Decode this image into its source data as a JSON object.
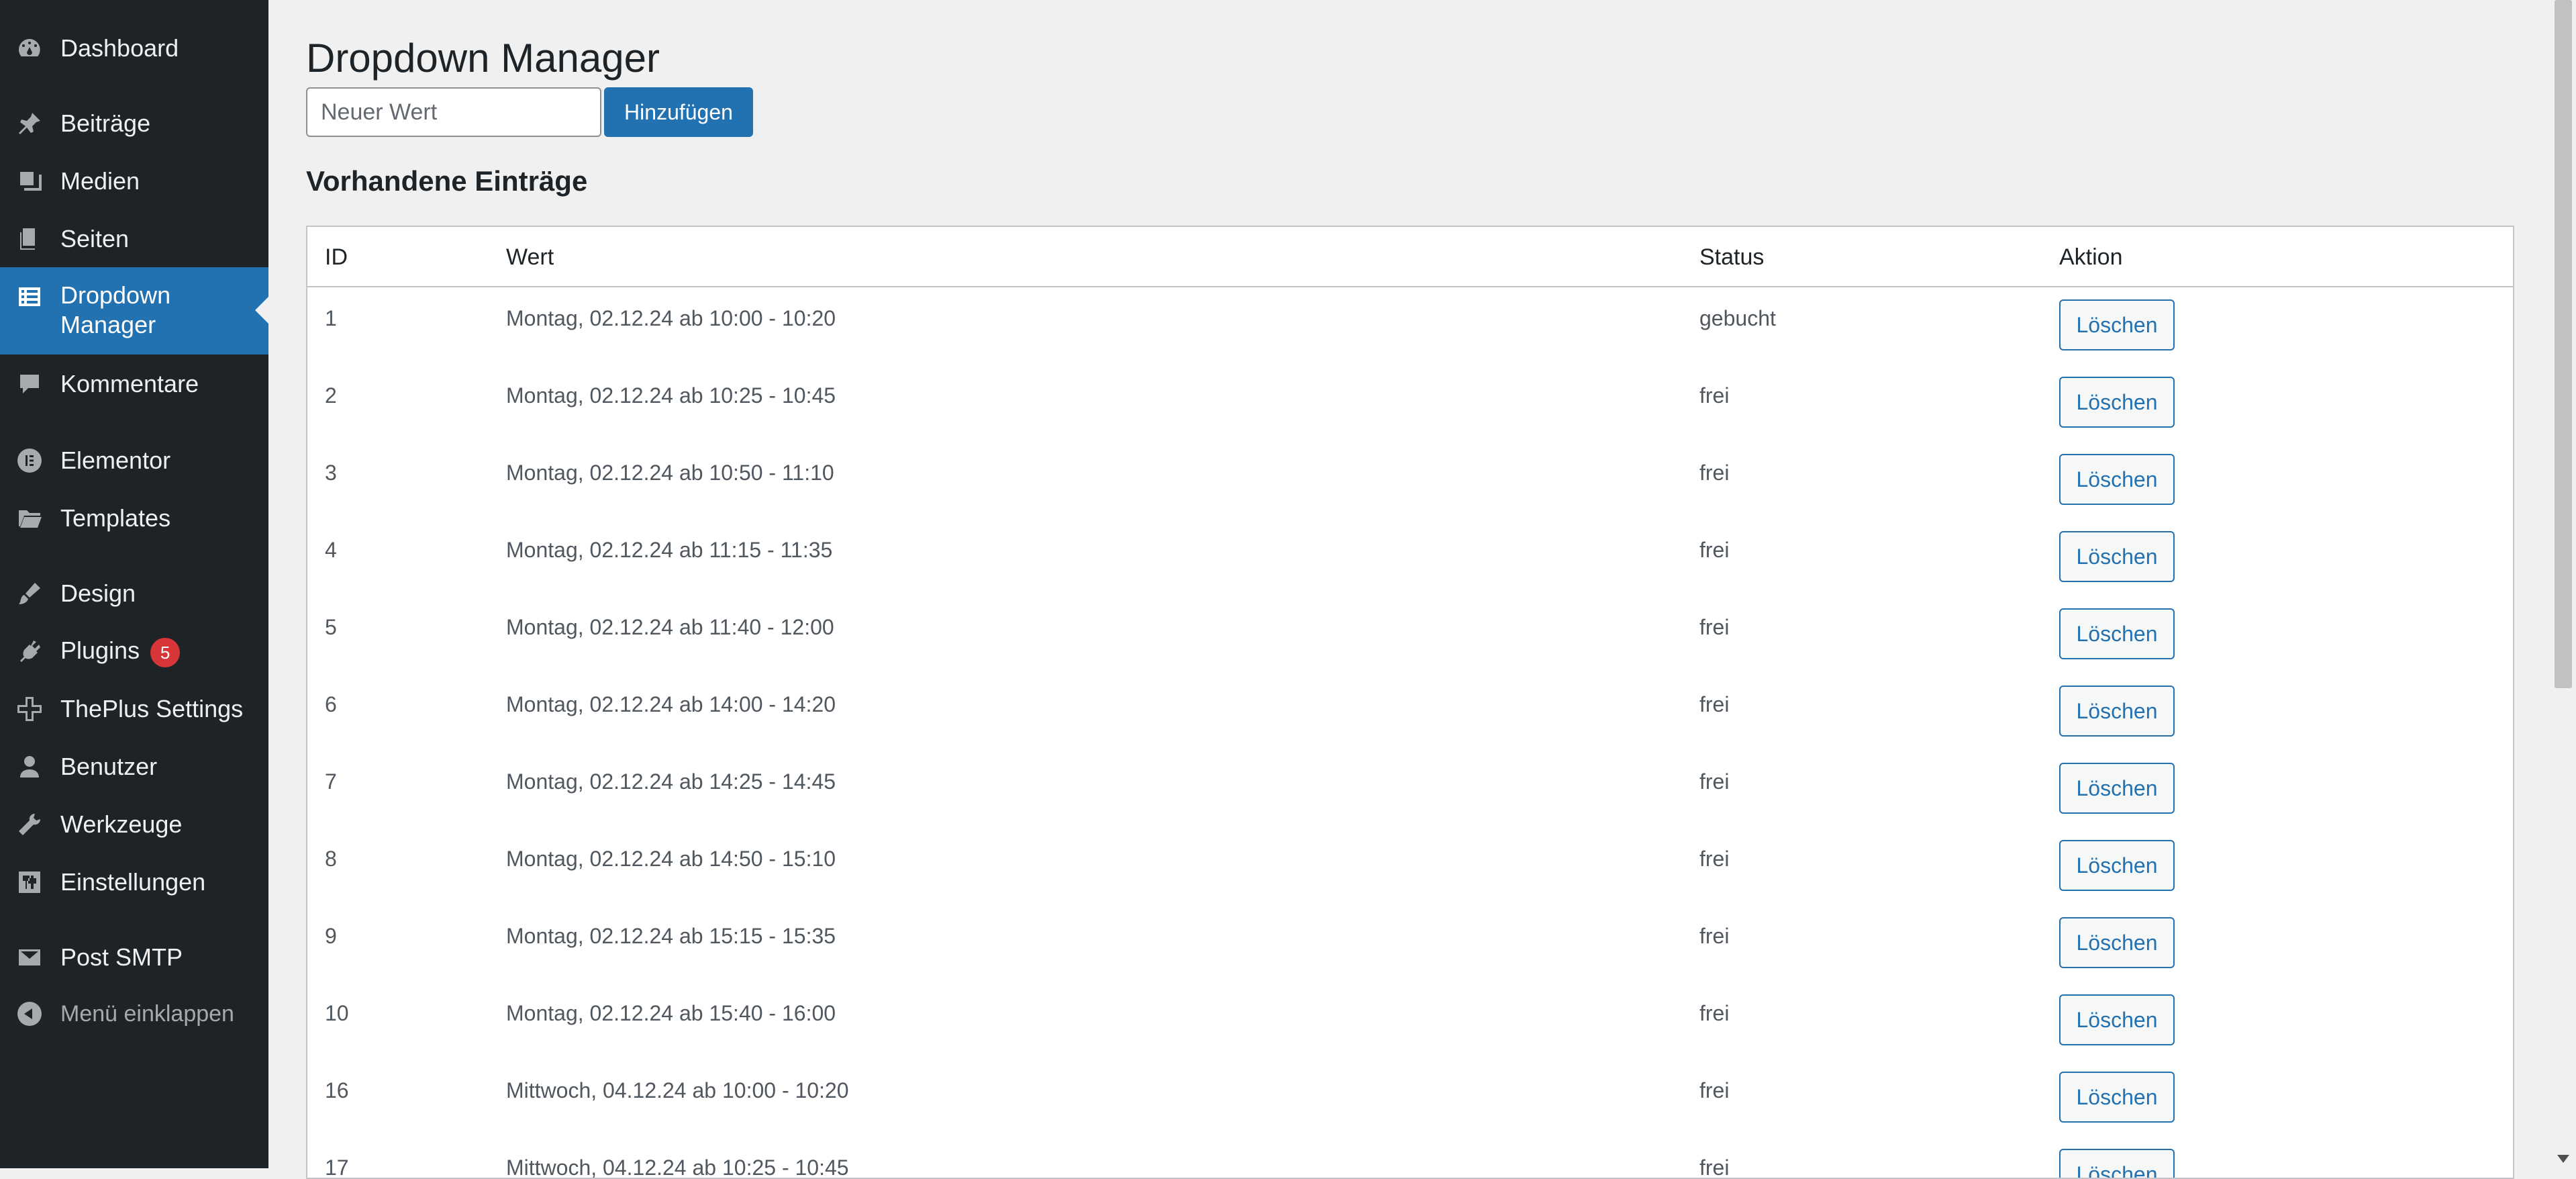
{
  "sidebar": {
    "items": [
      {
        "label": "Dashboard",
        "icon": "dashboard-icon"
      },
      {
        "label": "Beiträge",
        "icon": "pin-icon"
      },
      {
        "label": "Medien",
        "icon": "media-icon"
      },
      {
        "label": "Seiten",
        "icon": "pages-icon"
      },
      {
        "label": "Dropdown Manager",
        "icon": "list-icon",
        "active": true
      },
      {
        "label": "Kommentare",
        "icon": "comment-icon"
      },
      {
        "label": "Elementor",
        "icon": "elementor-icon"
      },
      {
        "label": "Templates",
        "icon": "folder-icon"
      },
      {
        "label": "Design",
        "icon": "brush-icon"
      },
      {
        "label": "Plugins",
        "icon": "plugin-icon",
        "badge": "5"
      },
      {
        "label": "ThePlus Settings",
        "icon": "plus-icon"
      },
      {
        "label": "Benutzer",
        "icon": "user-icon"
      },
      {
        "label": "Werkzeuge",
        "icon": "wrench-icon"
      },
      {
        "label": "Einstellungen",
        "icon": "settings-icon"
      },
      {
        "label": "Post SMTP",
        "icon": "mail-icon"
      },
      {
        "label": "Menü einklappen",
        "icon": "collapse-icon"
      }
    ],
    "dropdown_line1": "Dropdown",
    "dropdown_line2": "Manager"
  },
  "main": {
    "title": "Dropdown Manager",
    "input_placeholder": "Neuer Wert",
    "add_label": "Hinzufügen",
    "section_title": "Vorhandene Einträge",
    "columns": [
      "ID",
      "Wert",
      "Status",
      "Aktion"
    ],
    "delete_label": "Löschen",
    "rows": [
      {
        "id": "1",
        "wert": "Montag, 02.12.24 ab 10:00 - 10:20",
        "status": "gebucht"
      },
      {
        "id": "2",
        "wert": "Montag, 02.12.24 ab 10:25 - 10:45",
        "status": "frei"
      },
      {
        "id": "3",
        "wert": "Montag, 02.12.24 ab 10:50 - 11:10",
        "status": "frei"
      },
      {
        "id": "4",
        "wert": "Montag, 02.12.24 ab 11:15 - 11:35",
        "status": "frei"
      },
      {
        "id": "5",
        "wert": "Montag, 02.12.24 ab 11:40 - 12:00",
        "status": "frei"
      },
      {
        "id": "6",
        "wert": "Montag, 02.12.24 ab 14:00 - 14:20",
        "status": "frei"
      },
      {
        "id": "7",
        "wert": "Montag, 02.12.24 ab 14:25 - 14:45",
        "status": "frei"
      },
      {
        "id": "8",
        "wert": "Montag, 02.12.24 ab 14:50 - 15:10",
        "status": "frei"
      },
      {
        "id": "9",
        "wert": "Montag, 02.12.24 ab 15:15 - 15:35",
        "status": "frei"
      },
      {
        "id": "10",
        "wert": "Montag, 02.12.24 ab 15:40 - 16:00",
        "status": "frei"
      },
      {
        "id": "16",
        "wert": "Mittwoch, 04.12.24 ab 10:00 - 10:20",
        "status": "frei"
      },
      {
        "id": "17",
        "wert": "Mittwoch, 04.12.24 ab 10:25 - 10:45",
        "status": "frei"
      }
    ]
  },
  "colors": {
    "sidebar_bg": "#1d2327",
    "accent": "#2271b1",
    "badge": "#d63638",
    "page_bg": "#f0f0f1"
  }
}
